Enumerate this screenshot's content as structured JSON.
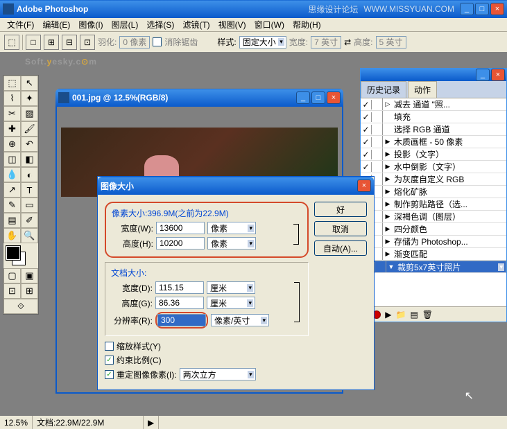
{
  "app": {
    "title": "Adobe Photoshop",
    "sub1": "思缘设计论坛",
    "sub2": "WWW.MISSYUAN.COM"
  },
  "menu": [
    "文件(F)",
    "编辑(E)",
    "图像(I)",
    "图层(L)",
    "选择(S)",
    "滤镜(T)",
    "视图(V)",
    "窗口(W)",
    "帮助(H)"
  ],
  "opt": {
    "feather": "羽化:",
    "featherVal": "0 像素",
    "anti": "消除锯齿",
    "style": "样式:",
    "styleVal": "固定大小",
    "w": "宽度:",
    "wVal": "7 英寸",
    "h": "高度:",
    "hVal": "5 英寸"
  },
  "watermark": {
    "p1": "Soft.",
    "p2": "y",
    "p3": "esky.c",
    "p4": "⊙",
    "p5": "m"
  },
  "doc": {
    "title": "001.jpg @ 12.5%(RGB/8)"
  },
  "dlg": {
    "title": "图像大小",
    "pxTitle": "像素大小:396.9M(之前为22.9M)",
    "wLbl": "宽度(W):",
    "wVal": "13600",
    "wUnit": "像素",
    "hLbl": "高度(H):",
    "hVal": "10200",
    "hUnit": "像素",
    "docTitle": "文档大小:",
    "dwLbl": "宽度(D):",
    "dwVal": "115.15",
    "dwUnit": "厘米",
    "dhLbl": "高度(G):",
    "dhVal": "86.36",
    "dhUnit": "厘米",
    "resLbl": "分辨率(R):",
    "resVal": "300",
    "resUnit": "像素/英寸",
    "cb1": "缩放样式(Y)",
    "cb2": "约束比例(C)",
    "cb3": "重定图像像素(I):",
    "resample": "两次立方",
    "ok": "好",
    "cancel": "取消",
    "auto": "自动(A)..."
  },
  "pal": {
    "tab1": "历史记录",
    "tab2": "动作",
    "items": [
      {
        "c": true,
        "a": "▷",
        "t": "减去 通道 \"照..."
      },
      {
        "c": true,
        "a": "",
        "t": "填充"
      },
      {
        "c": true,
        "a": "",
        "t": "选择 RGB 通道"
      },
      {
        "c": true,
        "a": "▶",
        "t": "木质画框 - 50 像素"
      },
      {
        "c": true,
        "a": "▶",
        "t": "投影（文字）"
      },
      {
        "c": true,
        "a": "▶",
        "t": "水中倒影（文字）"
      },
      {
        "c": true,
        "a": "▶",
        "t": "为灰度自定义 RGB"
      },
      {
        "c": true,
        "a": "▶",
        "t": "熔化矿脉"
      },
      {
        "c": true,
        "a": "▶",
        "t": "制作剪贴路径（选..."
      },
      {
        "c": true,
        "a": "▶",
        "t": "深褐色调（图层）"
      },
      {
        "c": true,
        "a": "▶",
        "t": "四分颜色"
      },
      {
        "c": true,
        "a": "▶",
        "t": "存储为 Photoshop..."
      },
      {
        "c": true,
        "a": "▶",
        "t": "渐变匹配"
      },
      {
        "c": true,
        "a": "▼",
        "t": "裁剪5x7英寸照片",
        "sel": true
      }
    ]
  },
  "status": {
    "zoom": "12.5%",
    "doc": "文档:22.9M/22.9M"
  }
}
